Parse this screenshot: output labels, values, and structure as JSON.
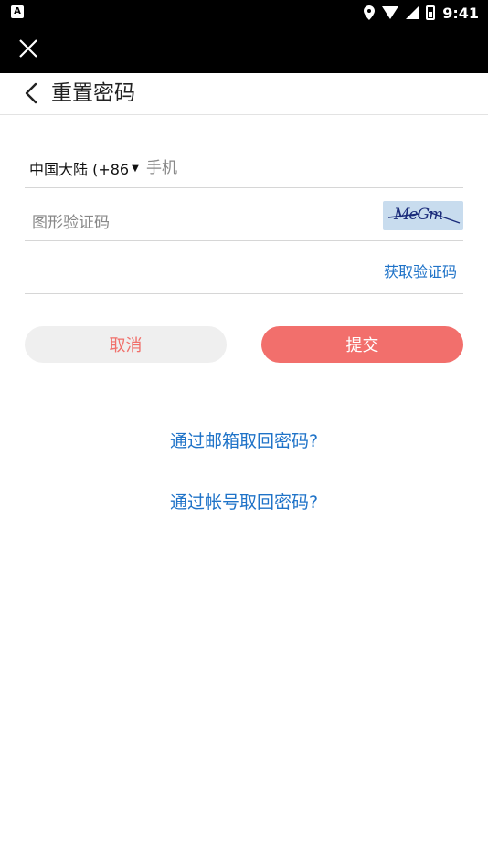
{
  "status_bar": {
    "time": "9:41",
    "badge": "A",
    "icons": [
      "location-icon",
      "wifi-icon",
      "signal-icon",
      "battery-icon"
    ]
  },
  "header": {
    "title": "重置密码"
  },
  "form": {
    "country_selector": "中国大陆 (+86",
    "phone_placeholder": "手机",
    "captcha_placeholder": "图形验证码",
    "captcha_text": "MeGm",
    "get_code_label": "获取验证码"
  },
  "buttons": {
    "cancel_label": "取消",
    "submit_label": "提交"
  },
  "links": {
    "email_recovery": "通过邮箱取回密码?",
    "account_recovery": "通过帐号取回密码?"
  },
  "colors": {
    "accent": "#f26f6c",
    "link": "#1f73c8",
    "cancel_bg": "#efefef"
  }
}
